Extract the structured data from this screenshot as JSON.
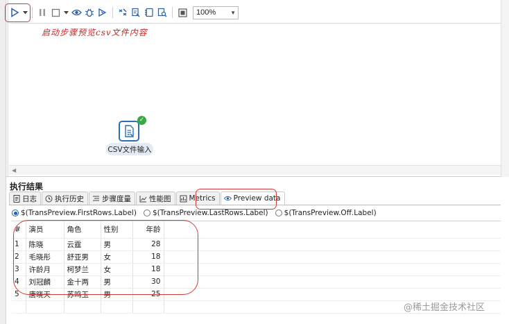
{
  "toolbar": {
    "zoom_value": "100%",
    "icons": [
      "run-icon",
      "run-dropdown-icon",
      "pause-icon",
      "stop-icon",
      "stop-dropdown-icon",
      "preview-icon",
      "debug-icon",
      "replay-icon",
      "verify-icon",
      "analyze-icon",
      "sql-icon",
      "explore-db-icon",
      "show-results-icon"
    ]
  },
  "annotations": {
    "run_note": "启动步骤预览csv文件内容",
    "color": "#d23a3a"
  },
  "canvas": {
    "step_label": "CSV文件输入",
    "step_status": "success"
  },
  "results": {
    "title": "执行结果",
    "tabs": [
      {
        "label": "日志",
        "icon": "log-icon"
      },
      {
        "label": "执行历史",
        "icon": "history-icon"
      },
      {
        "label": "步骤度量",
        "icon": "step-metrics-icon"
      },
      {
        "label": "性能图",
        "icon": "performance-chart-icon"
      },
      {
        "label": "Metrics",
        "icon": "metrics-icon"
      },
      {
        "label": "Preview data",
        "icon": "eye-icon"
      }
    ],
    "active_tab": "Preview data",
    "radios": [
      {
        "label": "$(TransPreview.FirstRows.Label)",
        "checked": true
      },
      {
        "label": "$(TransPreview.LastRows.Label)",
        "checked": false
      },
      {
        "label": "$(TransPreview.Off.Label)",
        "checked": false
      }
    ],
    "table": {
      "columns": [
        "#",
        "演员",
        "角色",
        "性别",
        "年龄"
      ],
      "rows": [
        [
          "1",
          "陈晓",
          "云霆",
          "男",
          "28"
        ],
        [
          "2",
          "毛晓彤",
          "舒亚男",
          "女",
          "18"
        ],
        [
          "3",
          "许龄月",
          "柯梦兰",
          "女",
          "18"
        ],
        [
          "4",
          "刘冠麟",
          "金十两",
          "男",
          "30"
        ],
        [
          "5",
          "唐晓天",
          "苏鸣玉",
          "男",
          "25"
        ]
      ]
    }
  },
  "watermark": "@稀土掘金技术社区"
}
